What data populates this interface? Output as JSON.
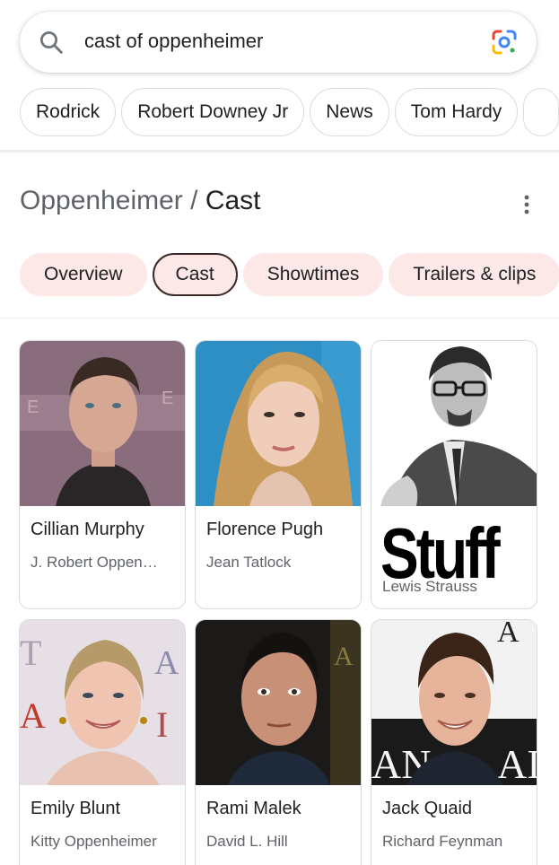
{
  "search": {
    "query": "cast of oppenheimer",
    "search_icon": "search-icon",
    "lens_icon": "google-lens-icon"
  },
  "chips": [
    "Rodrick",
    "Robert Downey Jr",
    "News",
    "Tom Hardy"
  ],
  "panel": {
    "title_parent": "Oppenheimer",
    "title_separator": "/",
    "title_current": "Cast",
    "more_icon": "more-vert-icon"
  },
  "tabs": [
    {
      "label": "Overview",
      "active": false
    },
    {
      "label": "Cast",
      "active": true
    },
    {
      "label": "Showtimes",
      "active": false
    },
    {
      "label": "Trailers & clips",
      "active": false
    }
  ],
  "cast": [
    {
      "name": "Cillian Murphy",
      "role": "J. Robert Oppen…"
    },
    {
      "name": "Florence Pugh",
      "role": "Jean Tatlock"
    },
    {
      "name": "Stuff",
      "role": "Lewis Strauss"
    },
    {
      "name": "Emily Blunt",
      "role": "Kitty Oppenheimer"
    },
    {
      "name": "Rami Malek",
      "role": "David L. Hill"
    },
    {
      "name": "Jack Quaid",
      "role": "Richard Feynman"
    }
  ],
  "colors": {
    "tab_bg": "#fce8e6",
    "active_tab_border": "#3c2a28",
    "text_primary": "#202124",
    "text_secondary": "#5f6368"
  }
}
